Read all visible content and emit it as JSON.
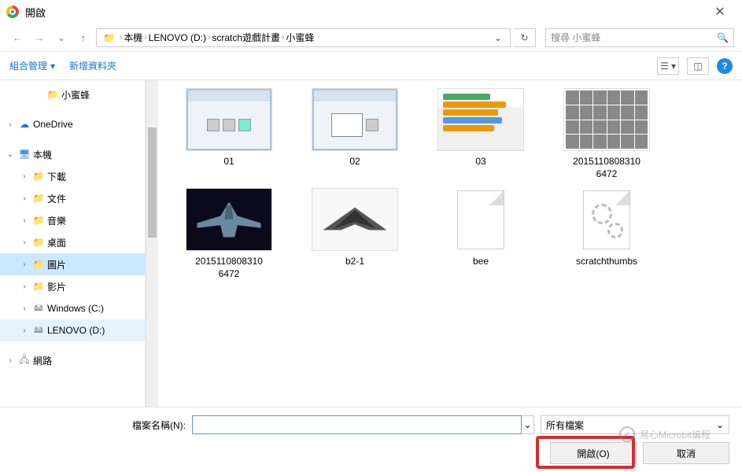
{
  "window": {
    "title": "開啟"
  },
  "breadcrumb": [
    "本機",
    "LENOVO (D:)",
    "scratch遊戲計畫",
    "小蜜蜂"
  ],
  "search": {
    "placeholder": "搜尋 小蜜蜂"
  },
  "toolbar": {
    "organize": "組合管理",
    "new_folder": "新增資料夾"
  },
  "tree": [
    {
      "label": "小蜜蜂",
      "icon": "folder",
      "indent": 2,
      "expand": ""
    },
    {
      "label": "OneDrive",
      "icon": "cloud",
      "indent": 0,
      "expand": "›",
      "gap": true
    },
    {
      "label": "本機",
      "icon": "pc",
      "indent": 0,
      "expand": "⌄",
      "gap": true
    },
    {
      "label": "下載",
      "icon": "folder",
      "indent": 1,
      "expand": "›"
    },
    {
      "label": "文件",
      "icon": "folder",
      "indent": 1,
      "expand": "›"
    },
    {
      "label": "音樂",
      "icon": "folder",
      "indent": 1,
      "expand": "›"
    },
    {
      "label": "桌面",
      "icon": "folder",
      "indent": 1,
      "expand": "›"
    },
    {
      "label": "圖片",
      "icon": "folder",
      "indent": 1,
      "expand": "›",
      "sel": true
    },
    {
      "label": "影片",
      "icon": "folder",
      "indent": 1,
      "expand": "›"
    },
    {
      "label": "Windows (C:)",
      "icon": "drive",
      "indent": 1,
      "expand": "›"
    },
    {
      "label": "LENOVO (D:)",
      "icon": "drive",
      "indent": 1,
      "expand": "›",
      "hov": true
    },
    {
      "label": "網路",
      "icon": "network",
      "indent": 0,
      "expand": "›",
      "gap": true
    }
  ],
  "items": [
    {
      "label": "01",
      "kind": "screenshot"
    },
    {
      "label": "02",
      "kind": "screenshot2"
    },
    {
      "label": "03",
      "kind": "scratch"
    },
    {
      "label": "2015110808310\n6472",
      "kind": "sprites"
    },
    {
      "label": "2015110808310\n6472",
      "kind": "fighter"
    },
    {
      "label": "b2-1",
      "kind": "stealth"
    },
    {
      "label": "bee",
      "kind": "blank"
    },
    {
      "label": "scratchthumbs",
      "kind": "config"
    }
  ],
  "footer": {
    "filename_label": "檔案名稱(N):",
    "filename_value": "",
    "filter": "所有檔案",
    "open": "開啟(O)",
    "cancel": "取消"
  },
  "watermark": "易心Microbit编程"
}
